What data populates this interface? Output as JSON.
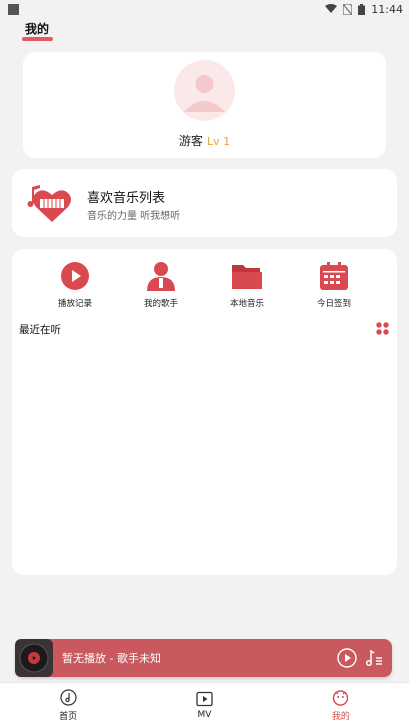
{
  "status_bar": {
    "time": "11:44"
  },
  "header": {
    "tab_label": "我的"
  },
  "profile": {
    "username": "游客",
    "level": "Lv 1"
  },
  "favorites": {
    "title": "喜欢音乐列表",
    "subtitle": "音乐的力量 听我想听"
  },
  "quick_actions": [
    {
      "label": "播放记录",
      "icon": "play-circle-icon"
    },
    {
      "label": "我的歌手",
      "icon": "singer-icon"
    },
    {
      "label": "本地音乐",
      "icon": "folder-icon"
    },
    {
      "label": "今日签到",
      "icon": "calendar-icon"
    }
  ],
  "recent": {
    "title": "最近在听"
  },
  "player": {
    "text": "暂无播放 - 歌手未知"
  },
  "bottom_nav": [
    {
      "label": "首页",
      "icon": "music-note-icon"
    },
    {
      "label": "MV",
      "icon": "video-icon"
    },
    {
      "label": "我的",
      "icon": "profile-face-icon",
      "active": true
    }
  ],
  "colors": {
    "accent": "#d94a50",
    "player_bg": "#c9595f",
    "level": "#e7a63c"
  }
}
